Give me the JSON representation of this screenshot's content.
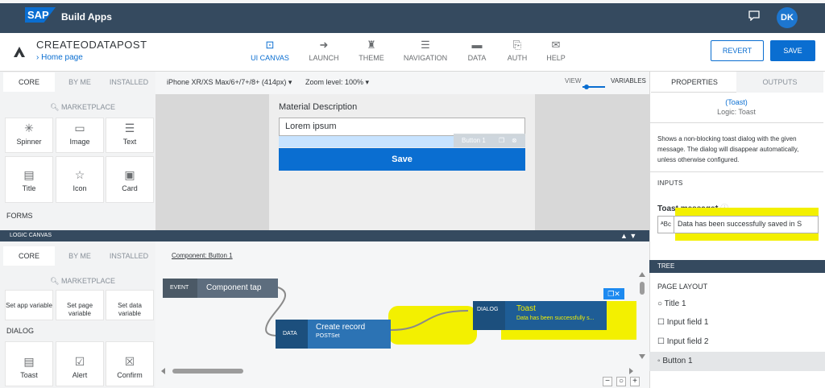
{
  "shell": {
    "logo": "SAP",
    "title": "Build  Apps",
    "avatar": "DK"
  },
  "header": {
    "project_title": "CREATEODATAPOST",
    "breadcrumb": "› Home page",
    "nav": [
      {
        "label": "UI CANVAS",
        "icon": "ui-canvas-icon",
        "active": true
      },
      {
        "label": "LAUNCH",
        "icon": "launch-icon"
      },
      {
        "label": "THEME",
        "icon": "theme-icon"
      },
      {
        "label": "NAVIGATION",
        "icon": "navigation-icon"
      },
      {
        "label": "DATA",
        "icon": "data-icon"
      },
      {
        "label": "AUTH",
        "icon": "auth-icon"
      },
      {
        "label": "HELP",
        "icon": "help-icon"
      }
    ],
    "revert": "REVERT",
    "save": "SAVE"
  },
  "palette": {
    "tabs": [
      "CORE",
      "BY ME",
      "INSTALLED"
    ],
    "search": "MARKETPLACE",
    "row1": [
      "Spinner",
      "Image",
      "Text"
    ],
    "row2": [
      "Title",
      "Icon",
      "Card"
    ],
    "forms": "FORMS"
  },
  "canvas": {
    "device": "iPhone XR/XS Max/6+/7+/8+ (414px) ▾",
    "zoom": "Zoom level: 100% ▾",
    "view": "VIEW",
    "variables": "VARIABLES",
    "field_label": "Material Description",
    "field_value": "Lorem ipsum",
    "overlay": "Button 1",
    "button": "Save"
  },
  "logic": {
    "bar": "LOGIC CANVAS",
    "tabs": [
      "CORE",
      "BY ME",
      "INSTALLED"
    ],
    "search": "MARKETPLACE",
    "row1": [
      "Set app variable",
      "Set page variable",
      "Set data variable"
    ],
    "dialog": "DIALOG",
    "row2": [
      "Toast",
      "Alert",
      "Confirm"
    ],
    "component": "Component: Button 1",
    "event_tag": "EVENT",
    "event_name": "Component tap",
    "data_tag": "DATA",
    "data_name": "Create record",
    "data_sub": "POSTSet",
    "dialog_tag": "DIALOG",
    "dialog_name": "Toast",
    "dialog_sub": "Data has been successfully s..."
  },
  "properties": {
    "tabs": [
      "PROPERTIES",
      "OUTPUTS"
    ],
    "type": "(Toast)",
    "logic": "Logic: Toast",
    "description": "Shows a non-blocking toast dialog with the given message. The dialog will disappear automatically, unless otherwise configured.",
    "inputs": "INPUTS",
    "toast_label": "Toast message*",
    "toast_value": "Data has been successfully saved in S",
    "tree": "TREE",
    "page_layout": "PAGE LAYOUT",
    "tree_items": [
      "Title 1",
      "Input field 1",
      "Input field 2",
      "Button 1"
    ]
  },
  "colors": {
    "shell": "#354a5f",
    "accent": "#0a6ed1",
    "node": "#2c6fa8",
    "highlight": "#f3f000"
  }
}
